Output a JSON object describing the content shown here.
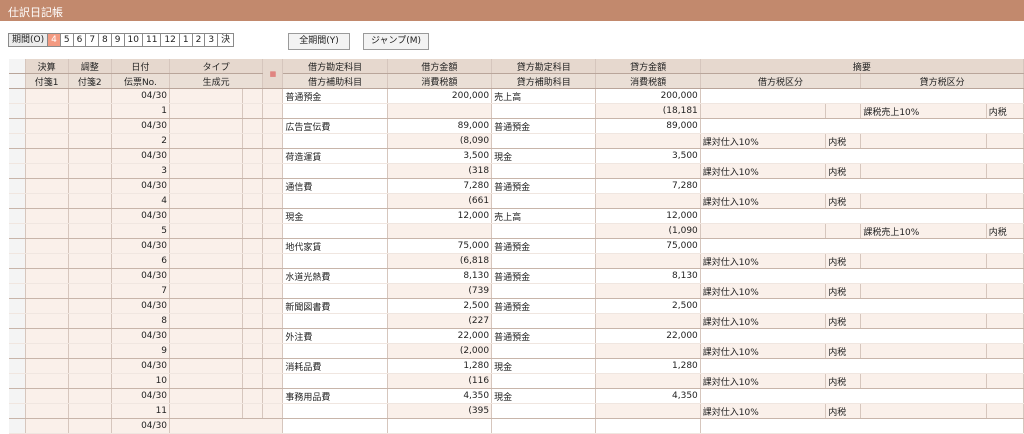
{
  "window": {
    "title": "仕訳日記帳"
  },
  "toolbar": {
    "period_label": "期間(O)",
    "months": [
      "4",
      "5",
      "6",
      "7",
      "8",
      "9",
      "10",
      "11",
      "12",
      "1",
      "2",
      "3",
      "決"
    ],
    "active_month_index": 0,
    "all_period_label": "全期間(Y)",
    "jump_label": "ジャンプ(M)"
  },
  "columns": {
    "row1": [
      "決算",
      "調整",
      "日付",
      "タイプ",
      "",
      "借方勘定科目",
      "借方金額",
      "貸方勘定科目",
      "貸方金額",
      "摘要"
    ],
    "row2": [
      "付箋1",
      "付箋2",
      "伝票No.",
      "生成元",
      "",
      "借方補助科目",
      "消費税額",
      "貸方補助科目",
      "消費税額",
      "借方税区分",
      "貸方税区分"
    ]
  },
  "entries": [
    {
      "date": "04/30",
      "no": "1",
      "debit_account": "普通預金",
      "debit_amount": "200,000",
      "credit_account": "売上高",
      "credit_amount": "200,000",
      "debit_tax": "",
      "credit_tax_amount": "(18,181",
      "debit_tax_cat": "",
      "debit_tax_mode": "",
      "credit_tax_cat": "課税売上10%",
      "credit_tax_mode": "内税"
    },
    {
      "date": "04/30",
      "no": "2",
      "debit_account": "広告宣伝費",
      "debit_amount": "89,000",
      "credit_account": "普通預金",
      "credit_amount": "89,000",
      "debit_tax": "(8,090",
      "credit_tax_amount": "",
      "debit_tax_cat": "課対仕入10%",
      "debit_tax_mode": "内税",
      "credit_tax_cat": "",
      "credit_tax_mode": ""
    },
    {
      "date": "04/30",
      "no": "3",
      "debit_account": "荷造運賃",
      "debit_amount": "3,500",
      "credit_account": "現金",
      "credit_amount": "3,500",
      "debit_tax": "(318",
      "credit_tax_amount": "",
      "debit_tax_cat": "課対仕入10%",
      "debit_tax_mode": "内税",
      "credit_tax_cat": "",
      "credit_tax_mode": ""
    },
    {
      "date": "04/30",
      "no": "4",
      "debit_account": "通信費",
      "debit_amount": "7,280",
      "credit_account": "普通預金",
      "credit_amount": "7,280",
      "debit_tax": "(661",
      "credit_tax_amount": "",
      "debit_tax_cat": "課対仕入10%",
      "debit_tax_mode": "内税",
      "credit_tax_cat": "",
      "credit_tax_mode": ""
    },
    {
      "date": "04/30",
      "no": "5",
      "debit_account": "現金",
      "debit_amount": "12,000",
      "credit_account": "売上高",
      "credit_amount": "12,000",
      "debit_tax": "",
      "credit_tax_amount": "(1,090",
      "debit_tax_cat": "",
      "debit_tax_mode": "",
      "credit_tax_cat": "課税売上10%",
      "credit_tax_mode": "内税"
    },
    {
      "date": "04/30",
      "no": "6",
      "debit_account": "地代家賃",
      "debit_amount": "75,000",
      "credit_account": "普通預金",
      "credit_amount": "75,000",
      "debit_tax": "(6,818",
      "credit_tax_amount": "",
      "debit_tax_cat": "課対仕入10%",
      "debit_tax_mode": "内税",
      "credit_tax_cat": "",
      "credit_tax_mode": ""
    },
    {
      "date": "04/30",
      "no": "7",
      "debit_account": "水道光熱費",
      "debit_amount": "8,130",
      "credit_account": "普通預金",
      "credit_amount": "8,130",
      "debit_tax": "(739",
      "credit_tax_amount": "",
      "debit_tax_cat": "課対仕入10%",
      "debit_tax_mode": "内税",
      "credit_tax_cat": "",
      "credit_tax_mode": ""
    },
    {
      "date": "04/30",
      "no": "8",
      "debit_account": "新聞図書費",
      "debit_amount": "2,500",
      "credit_account": "普通預金",
      "credit_amount": "2,500",
      "debit_tax": "(227",
      "credit_tax_amount": "",
      "debit_tax_cat": "課対仕入10%",
      "debit_tax_mode": "内税",
      "credit_tax_cat": "",
      "credit_tax_mode": ""
    },
    {
      "date": "04/30",
      "no": "9",
      "debit_account": "外注費",
      "debit_amount": "22,000",
      "credit_account": "普通預金",
      "credit_amount": "22,000",
      "debit_tax": "(2,000",
      "credit_tax_amount": "",
      "debit_tax_cat": "課対仕入10%",
      "debit_tax_mode": "内税",
      "credit_tax_cat": "",
      "credit_tax_mode": ""
    },
    {
      "date": "04/30",
      "no": "10",
      "debit_account": "消耗品費",
      "debit_amount": "1,280",
      "credit_account": "現金",
      "credit_amount": "1,280",
      "debit_tax": "(116",
      "credit_tax_amount": "",
      "debit_tax_cat": "課対仕入10%",
      "debit_tax_mode": "内税",
      "credit_tax_cat": "",
      "credit_tax_mode": ""
    },
    {
      "date": "04/30",
      "no": "11",
      "debit_account": "事務用品費",
      "debit_amount": "4,350",
      "credit_account": "現金",
      "credit_amount": "4,350",
      "debit_tax": "(395",
      "credit_tax_amount": "",
      "debit_tax_cat": "課対仕入10%",
      "debit_tax_mode": "内税",
      "credit_tax_cat": "",
      "credit_tax_mode": ""
    }
  ],
  "partial_row": {
    "date": "04/30"
  }
}
